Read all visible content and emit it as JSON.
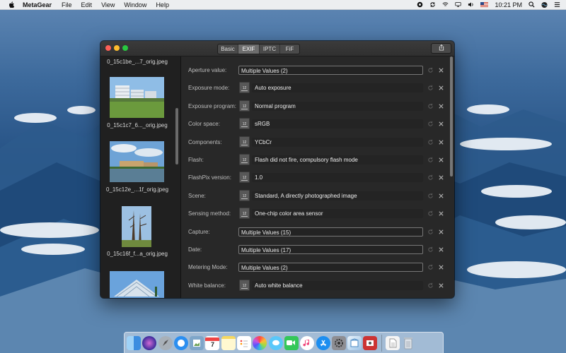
{
  "menubar": {
    "app_name": "MetaGear",
    "menus": [
      "File",
      "Edit",
      "View",
      "Window",
      "Help"
    ],
    "clock": "10:21 PM",
    "status_icons": [
      "scroll-icon",
      "sync-icon",
      "wifi-icon",
      "airplay-icon",
      "volume-icon",
      "us-flag-icon",
      "search-icon",
      "siri-icon",
      "list-icon"
    ]
  },
  "window": {
    "tabs": [
      {
        "label": "Basic",
        "active": false
      },
      {
        "label": "EXIF",
        "active": true
      },
      {
        "label": "IPTC",
        "active": false
      },
      {
        "label": "FiF",
        "active": false
      }
    ]
  },
  "sidebar": {
    "items": [
      {
        "caption": "0_15c1be_...7_orig.jpeg"
      },
      {
        "caption": "0_15c1c7_6..._orig.jpeg"
      },
      {
        "caption": "0_15c12e_...1f_orig.jpeg"
      },
      {
        "caption": "0_15c16f_f...a_orig.jpeg"
      }
    ]
  },
  "fields": [
    {
      "label": "Aperture value:",
      "value": "Multiple Values (2)",
      "kind": "multi"
    },
    {
      "label": "Exposure mode:",
      "value": "Auto exposure",
      "kind": "popup"
    },
    {
      "label": "Exposure program:",
      "value": "Normal program",
      "kind": "popup"
    },
    {
      "label": "Color space:",
      "value": "sRGB",
      "kind": "popup"
    },
    {
      "label": "Components:",
      "value": "YCbCr",
      "kind": "popup"
    },
    {
      "label": "Flash:",
      "value": "Flash did not fire, compulsory flash mode",
      "kind": "popup"
    },
    {
      "label": "FlashPix version:",
      "value": "1.0",
      "kind": "popup"
    },
    {
      "label": "Scene:",
      "value": "Standard, A directly photographed image",
      "kind": "popup"
    },
    {
      "label": "Sensing method:",
      "value": "One-chip color area sensor",
      "kind": "popup"
    },
    {
      "label": "Capture:",
      "value": "Multiple Values (15)",
      "kind": "multi"
    },
    {
      "label": "Date:",
      "value": "Multiple Values (17)",
      "kind": "multi"
    },
    {
      "label": "Metering Mode:",
      "value": "Multiple Values (2)",
      "kind": "multi"
    },
    {
      "label": "White balance:",
      "value": "Auto white balance",
      "kind": "popup"
    }
  ],
  "popup_icon_label": "12",
  "dock": {
    "apps": [
      "finder-icon",
      "siri-icon",
      "launchpad-icon",
      "safari-icon",
      "preview-icon",
      "calendar-icon",
      "notes-icon",
      "reminders-icon",
      "photos-icon",
      "messages-icon",
      "facetime-icon",
      "music-icon",
      "app-store-icon",
      "system-preferences-icon",
      "metagear-icon",
      "photo-booth-icon"
    ],
    "calendar_day": "7"
  },
  "colors": {
    "accent": "#5b9ae8",
    "close": "#fc5f57",
    "minimize": "#fdbc2e",
    "maximize": "#28c840"
  }
}
